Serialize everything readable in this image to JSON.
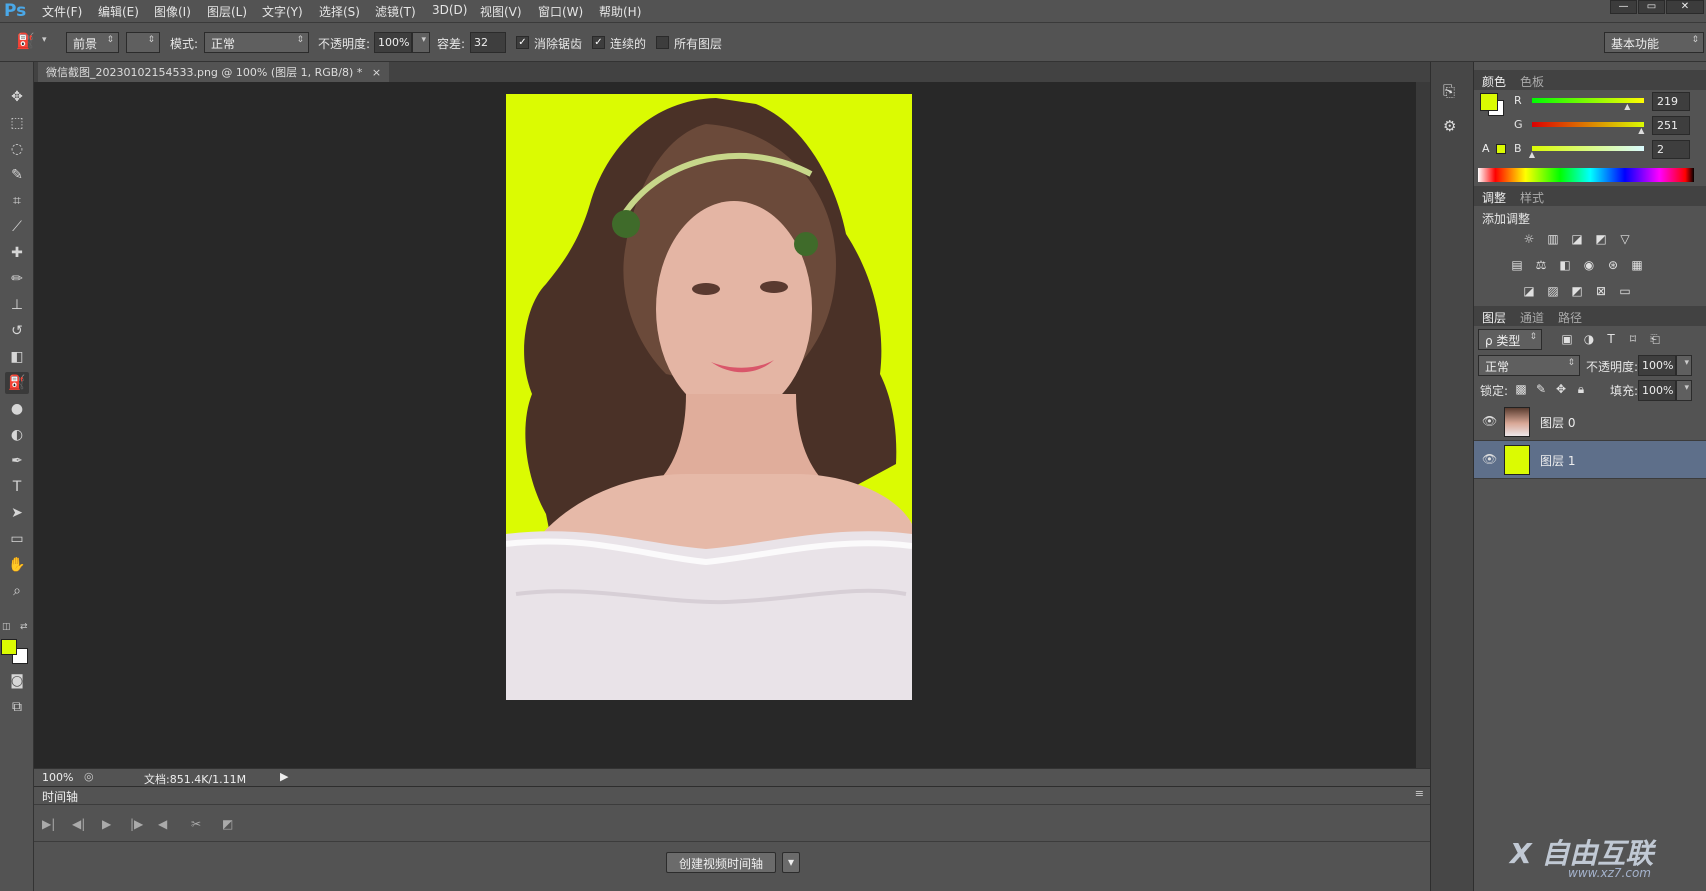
{
  "app": {
    "logo": "Ps"
  },
  "menu": [
    "文件(F)",
    "编辑(E)",
    "图像(I)",
    "图层(L)",
    "文字(Y)",
    "选择(S)",
    "滤镜(T)",
    "3D(D)",
    "视图(V)",
    "窗口(W)",
    "帮助(H)"
  ],
  "window_controls": {
    "minimize": "—",
    "maximize": "▭",
    "close": "✕"
  },
  "options": {
    "fill_source": "前景",
    "mode_label": "模式:",
    "mode_value": "正常",
    "opacity_label": "不透明度:",
    "opacity_value": "100%",
    "tolerance_label": "容差:",
    "tolerance_value": "32",
    "antialias_label": "消除锯齿",
    "contiguous_label": "连续的",
    "all_layers_label": "所有图层",
    "workspace": "基本功能"
  },
  "document": {
    "tab_title": "微信截图_20230102154533.png @ 100% (图层 1, RGB/8) *",
    "tab_close": "×"
  },
  "status": {
    "zoom": "100%",
    "doc_info": "文档:851.4K/1.11M"
  },
  "timeline": {
    "title": "时间轴",
    "create_button": "创建视频时间轴"
  },
  "color_panel": {
    "tabs": [
      "颜色",
      "色板"
    ],
    "r_label": "R",
    "g_label": "G",
    "b_label": "B",
    "r": "219",
    "g": "251",
    "b": "2",
    "r_fraction": 0.859,
    "g_fraction": 0.984,
    "b_fraction": 0.008,
    "foreground": "#dbfb02",
    "background": "#ffffff"
  },
  "adjust_panel": {
    "tabs": [
      "调整",
      "样式"
    ],
    "title": "添加调整"
  },
  "layers_panel": {
    "tabs": [
      "图层",
      "通道",
      "路径"
    ],
    "filter_type": "ρ 类型",
    "blend_mode": "正常",
    "opacity_label": "不透明度:",
    "opacity": "100%",
    "lock_label": "锁定:",
    "fill_label": "填充:",
    "fill": "100%",
    "layers": [
      {
        "name": "图层 0",
        "selected": false
      },
      {
        "name": "图层 1",
        "selected": true
      }
    ]
  },
  "watermark": {
    "text": "X 自由互联",
    "sub": "www.xz7.com"
  },
  "colors": {
    "accent_fill": "#dbfb02",
    "selected_layer": "#5e6f8a"
  }
}
